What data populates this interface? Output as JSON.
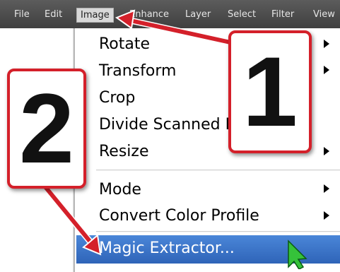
{
  "menubar": {
    "items": [
      {
        "label": "File"
      },
      {
        "label": "Edit"
      },
      {
        "label": "Image",
        "active": true
      },
      {
        "label": "Enhance"
      },
      {
        "label": "Layer"
      },
      {
        "label": "Select"
      },
      {
        "label": "Filter"
      },
      {
        "label": "View"
      }
    ]
  },
  "image_menu": {
    "items": [
      {
        "label": "Rotate",
        "has_submenu": true
      },
      {
        "label": "Transform",
        "has_submenu": true
      },
      {
        "label": "Crop",
        "has_submenu": false
      },
      {
        "label": "Divide Scanned Photos",
        "has_submenu": false
      },
      {
        "label": "Resize",
        "has_submenu": true
      },
      {
        "label": "Mode",
        "has_submenu": true
      },
      {
        "label": "Convert Color Profile",
        "has_submenu": true
      },
      {
        "label": "Magic Extractor...",
        "has_submenu": false,
        "highlighted": true
      }
    ]
  },
  "callouts": {
    "step1": "1",
    "step2": "2"
  },
  "colors": {
    "callout_red": "#d4202a",
    "highlight_blue": "#3a72c8",
    "menubar_bg": "#4a4a4a"
  },
  "icons": {
    "cursor": "arrow-cursor-icon"
  }
}
